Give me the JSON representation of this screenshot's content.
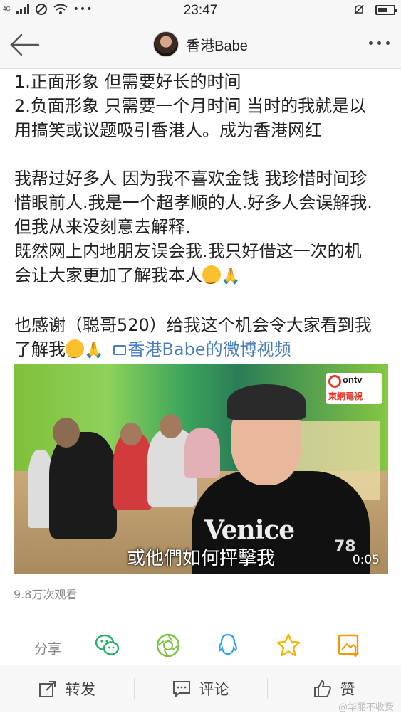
{
  "status_bar": {
    "network": "4G",
    "time": "23:47",
    "more": "•••",
    "battery_level": 0.6
  },
  "nav": {
    "title": "香港Babe",
    "back_icon": "arrow-left-icon",
    "more_icon": "more-dots-icon"
  },
  "post": {
    "lines": [
      " 1.正面形象 但需要好长的时间",
      "2.负面形象 只需要一个月时间 当时的我就是以",
      "用搞笑或议题吸引香港人。成为香港网红",
      "",
      "我帮过好多人 因为我不喜欢金钱 我珍惜时间珍",
      "惜眼前人.我是一个超孝顺的人.好多人会误解我.",
      "但我从来没刻意去解释.",
      "既然网上内地朋友误会我.我只好借这一次的机",
      "会让大家更加了解我本人"
    ],
    "thanks_line": "也感谢（聪哥520）给我这个机会令大家看到我",
    "last_line": "了解我",
    "video_link": "香港Babe的微博视频"
  },
  "video": {
    "subtitle": "或他們如何抨擊我",
    "duration": "0:05",
    "logo_top": "ontv",
    "logo_bottom": "東網電視",
    "shirt_text": "Venice",
    "shirt_number": "78"
  },
  "views": "9.8万次观看",
  "share": {
    "label": "分享",
    "icons": [
      "wechat-icon",
      "moments-icon",
      "qq-icon",
      "qzone-icon",
      "save-image-icon"
    ],
    "colors": {
      "wechat": "#2aae67",
      "moments": "#7ac143",
      "qq": "#2fa0e6",
      "qzone": "#f7b500",
      "save": "#f39800"
    }
  },
  "toolbar": {
    "repost": "转发",
    "comment": "评论",
    "like": "赞"
  },
  "watermark": "@华丽不收费"
}
